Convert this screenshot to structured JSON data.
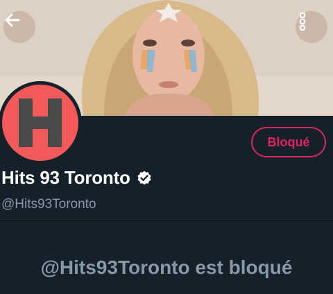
{
  "header": {
    "back_icon": "arrow-left-icon",
    "more_icon": "more-vertical-icon"
  },
  "profile": {
    "avatar_letter": "H",
    "display_name": "Hits 93 Toronto",
    "handle": "@Hits93Toronto",
    "verified_icon": "verified-badge-icon",
    "blocked_button_label": "Bloqué"
  },
  "timeline": {
    "blocked_message": "@Hits93Toronto est bloqué"
  },
  "colors": {
    "background": "#15202b",
    "accent_red": "#e0245e",
    "avatar_bg": "#f25a5a",
    "secondary_text": "#8899a6"
  }
}
